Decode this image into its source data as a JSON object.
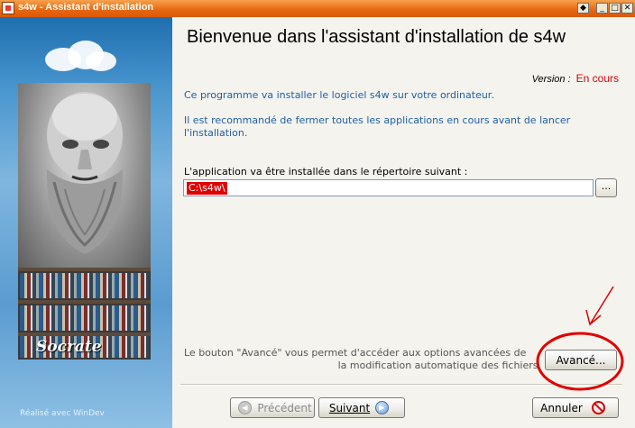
{
  "window": {
    "title": "s4w - Assistant d'installation",
    "controls": {
      "extra": "◆",
      "minimize": "_",
      "maximize": "□",
      "close": "✕"
    }
  },
  "sidebar": {
    "caption": "Socrate",
    "footer": "Réalisé avec WinDev"
  },
  "main": {
    "heading": "Bienvenue dans l'assistant d'installation de s4w",
    "version_label": "Version :",
    "version_value": "En cours",
    "paragraph1": "Ce programme va installer le logiciel s4w sur votre ordinateur.",
    "paragraph2": "Il est recommandé de fermer toutes les applications en cours avant de lancer l'installation.",
    "directory_label": "L'application va être installée dans le répertoire suivant :",
    "directory_value": "C:\\s4w\\",
    "browse_label": "...",
    "advanced_hint_line1": "Le bouton \"Avancé\" vous permet d'accéder aux options avancées de",
    "advanced_hint_line2": "la modification automatique des fichiers.",
    "advanced_button": "Avancé..."
  },
  "buttons": {
    "previous": "Précédent",
    "next": "Suivant",
    "cancel": "Annuler"
  },
  "colors": {
    "titlebar": "#e8650f",
    "text_blue": "#1f5fa8",
    "version_red": "#dd0000",
    "annotation_red": "#e00000"
  }
}
